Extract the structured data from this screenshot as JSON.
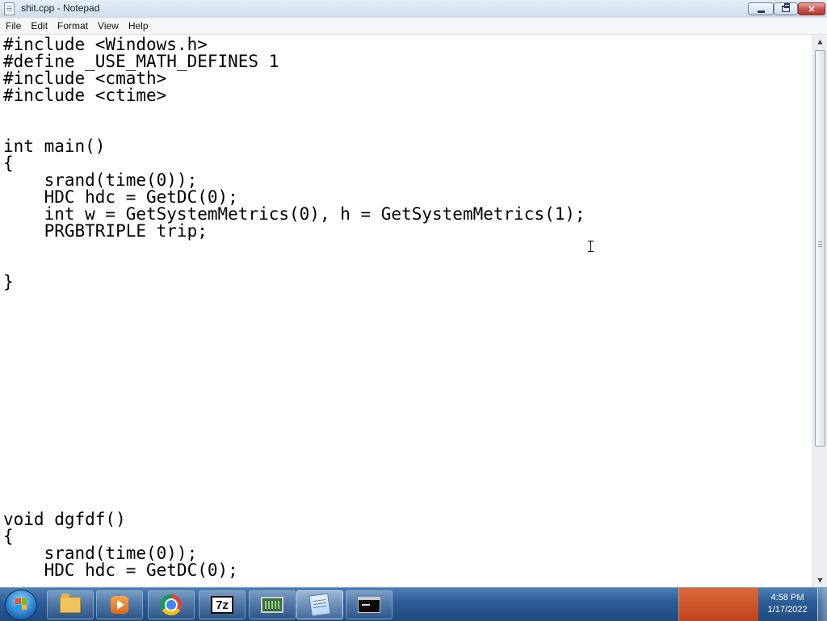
{
  "window": {
    "title": "shit.cpp - Notepad",
    "icon": "notepad-icon",
    "controls": {
      "minimize": "minimize-icon",
      "maximize": "restore-icon",
      "close": "×"
    }
  },
  "menu": [
    "File",
    "Edit",
    "Format",
    "View",
    "Help"
  ],
  "editor": {
    "lines": [
      "#include <Windows.h>",
      "#define _USE_MATH_DEFINES 1",
      "#include <cmath>",
      "#include <ctime>",
      "",
      "",
      "int main()",
      "{",
      "    srand(time(0));",
      "    HDC hdc = GetDC(0);",
      "    int w = GetSystemMetrics(0), h = GetSystemMetrics(1);",
      "    PRGBTRIPLE trip;",
      "",
      "",
      "}",
      "",
      "",
      "",
      "",
      "",
      "",
      "",
      "",
      "",
      "",
      "",
      "",
      "",
      "void dgfdf()",
      "{",
      "    srand(time(0));",
      "    HDC hdc = GetDC(0);"
    ]
  },
  "scrollbar": {
    "up": "▲",
    "down": "▼"
  },
  "taskbar": {
    "start": "windows-start-icon",
    "apps": [
      "folder-icon",
      "media-player-icon",
      "chrome-icon",
      "7zip-icon",
      "monitor-icon",
      "notepad-icon",
      "cmd-icon"
    ],
    "clock": {
      "time": "4:58 PM",
      "date": "1/17/2022"
    }
  },
  "colors": {
    "taskbar": "#2e5f98",
    "close": "#c75050",
    "tray_accent": "#c2421c"
  }
}
